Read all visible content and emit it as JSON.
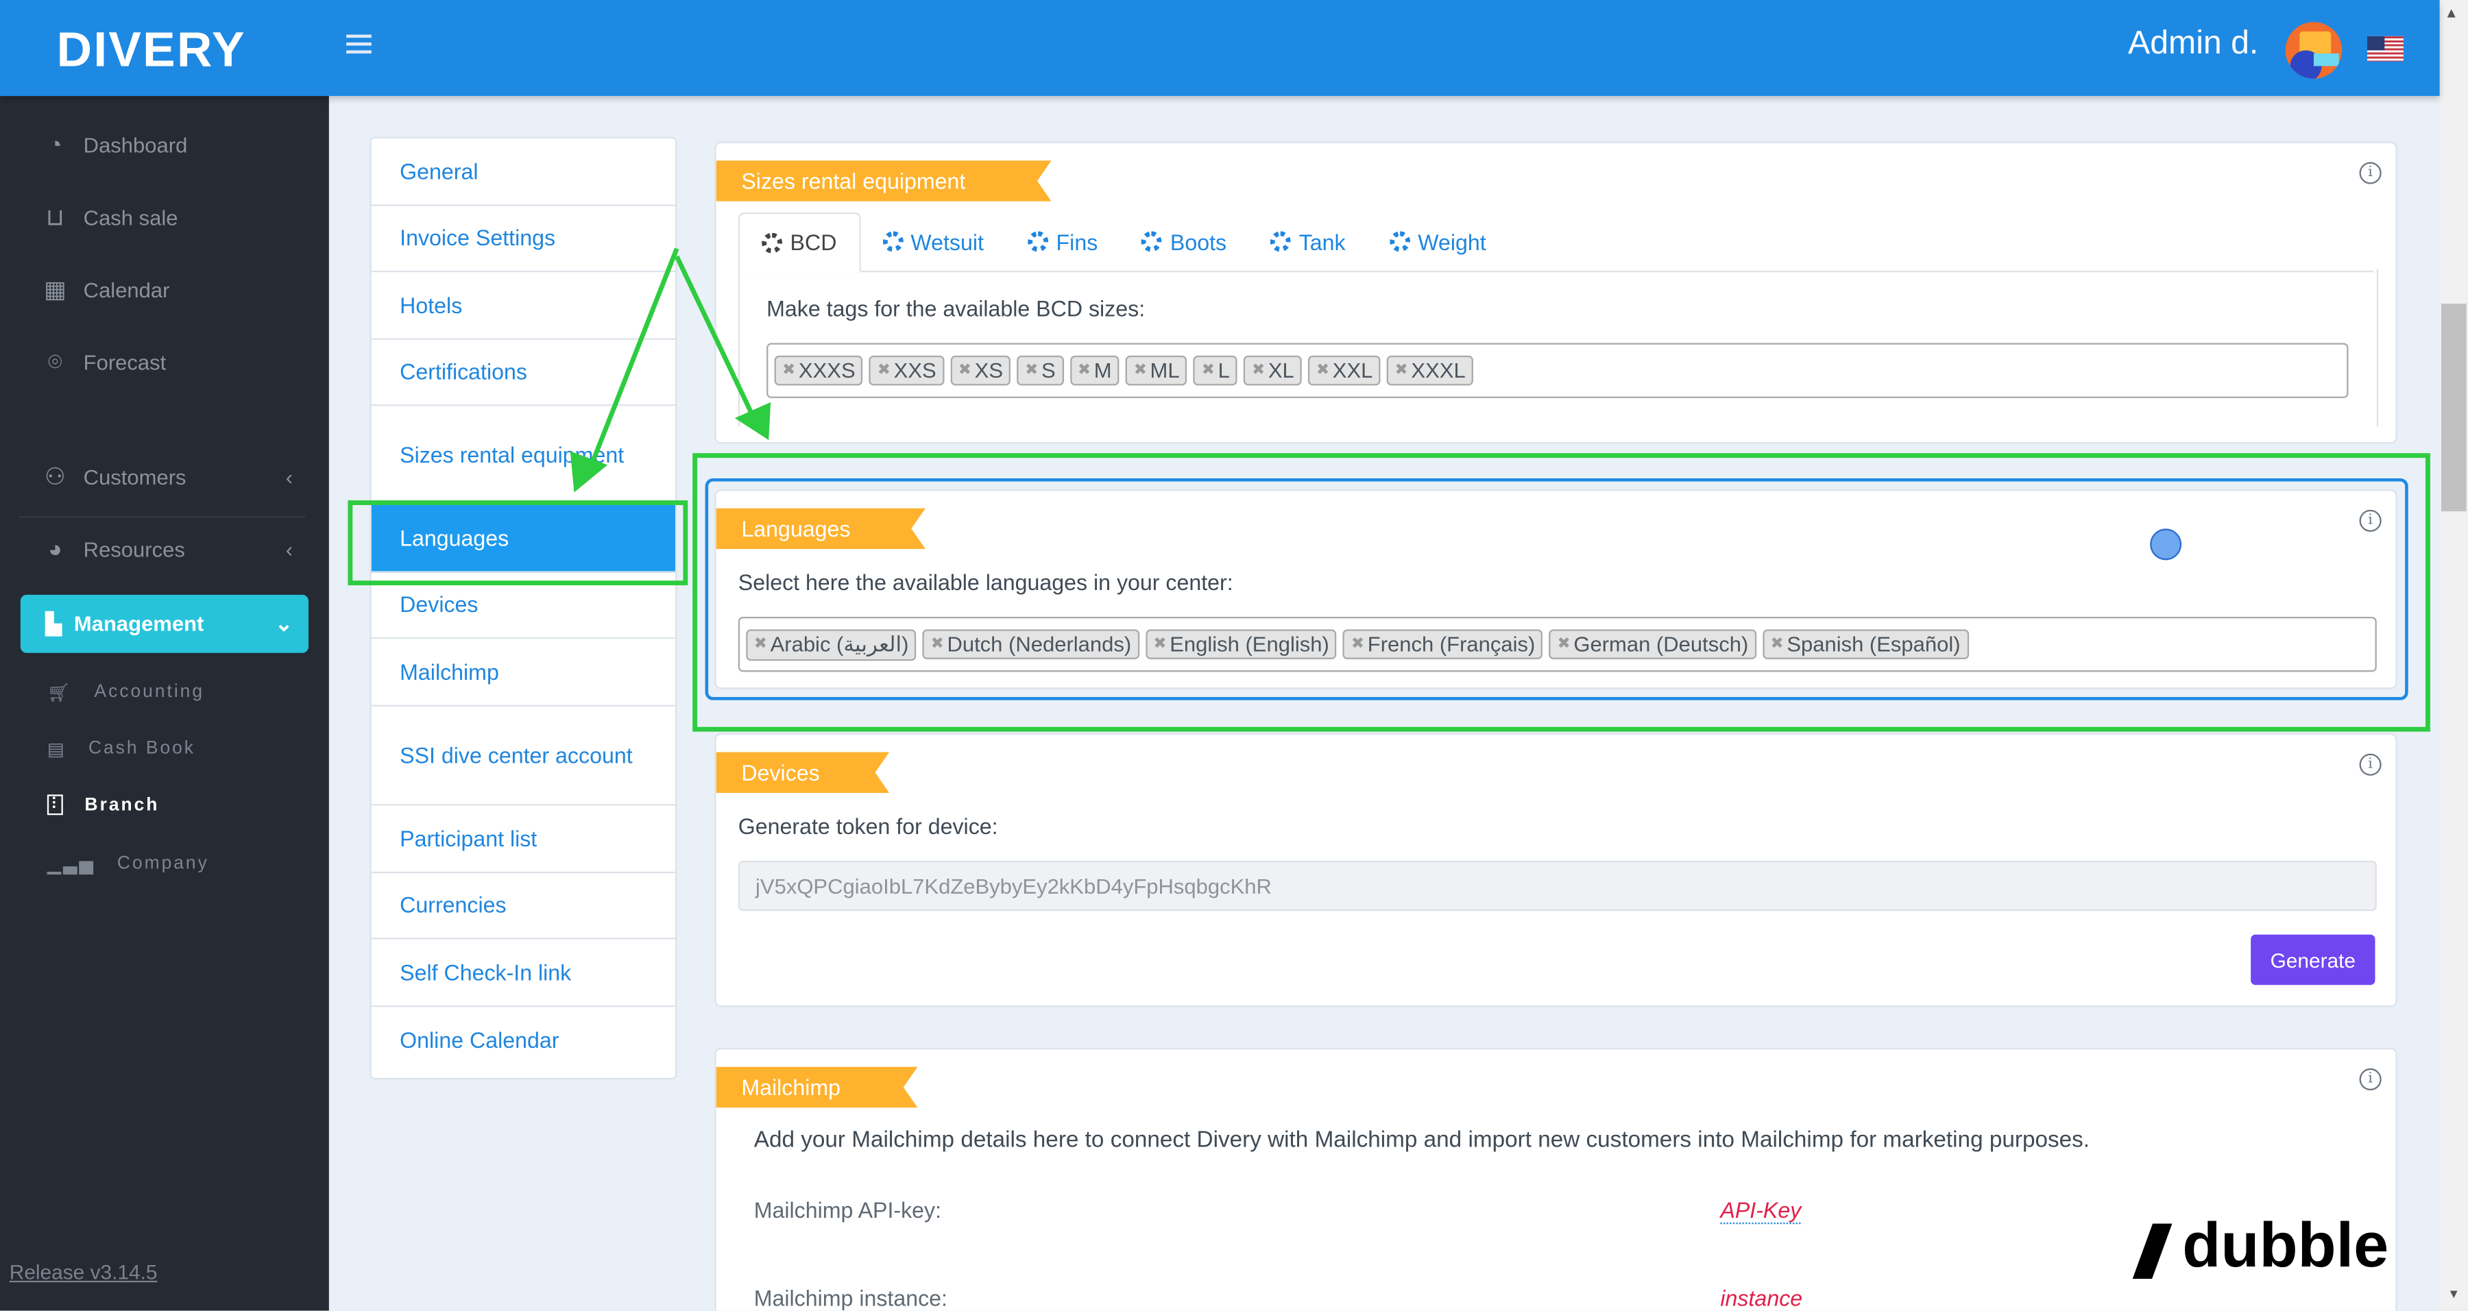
{
  "header": {
    "logo": "DIVERY",
    "user": "Admin d.",
    "language": "en-US"
  },
  "sidebar": {
    "items": [
      {
        "label": "Dashboard",
        "icon": "speedometer-icon"
      },
      {
        "label": "Cash sale",
        "icon": "cart-icon"
      },
      {
        "label": "Calendar",
        "icon": "calendar-icon"
      },
      {
        "label": "Forecast",
        "icon": "map-pin-icon"
      }
    ],
    "groups": [
      {
        "label": "Customers",
        "icon": "users-icon"
      },
      {
        "label": "Resources",
        "icon": "gauge-icon"
      }
    ],
    "management": {
      "label": "Management",
      "sub": [
        {
          "label": "Accounting"
        },
        {
          "label": "Cash Book"
        },
        {
          "label": "Branch"
        },
        {
          "label": "Company"
        }
      ]
    },
    "release": "Release v3.14.5"
  },
  "subnav": [
    "General",
    "Invoice Settings",
    "Hotels",
    "Certifications",
    "Sizes rental equipment",
    "Languages",
    "Devices",
    "Mailchimp",
    "SSI dive center account",
    "Participant list",
    "Currencies",
    "Self Check-In link",
    "Online Calendar"
  ],
  "sizes": {
    "title": "Sizes rental equipment",
    "tabs": [
      "BCD",
      "Wetsuit",
      "Fins",
      "Boots",
      "Tank",
      "Weight"
    ],
    "label": "Make tags for the available BCD sizes:",
    "tags": [
      "XXXS",
      "XXS",
      "XS",
      "S",
      "M",
      "ML",
      "L",
      "XL",
      "XXL",
      "XXXL"
    ]
  },
  "languages": {
    "title": "Languages",
    "label": "Select here the available languages in your center:",
    "tags": [
      "Arabic (العربية)",
      "Dutch (Nederlands)",
      "English (English)",
      "French (Français)",
      "German (Deutsch)",
      "Spanish (Español)"
    ]
  },
  "devices": {
    "title": "Devices",
    "label": "Generate token for device:",
    "token": "jV5xQPCgiaoIbL7KdZeBybyEy2kKbD4yFpHsqbgcKhR",
    "button": "Generate"
  },
  "mailchimp": {
    "title": "Mailchimp",
    "desc": "Add your Mailchimp details here to connect Divery with Mailchimp and import new customers into Mailchimp for marketing purposes.",
    "api_label": "Mailchimp API-key:",
    "api_value": "API-Key",
    "instance_label": "Mailchimp instance:",
    "instance_value": "instance"
  },
  "watermark": "dubble",
  "colors": {
    "header": "#1e89e3",
    "ribbon": "#ffb22d",
    "highlight": "#2ecc40",
    "button": "#7046f0"
  }
}
